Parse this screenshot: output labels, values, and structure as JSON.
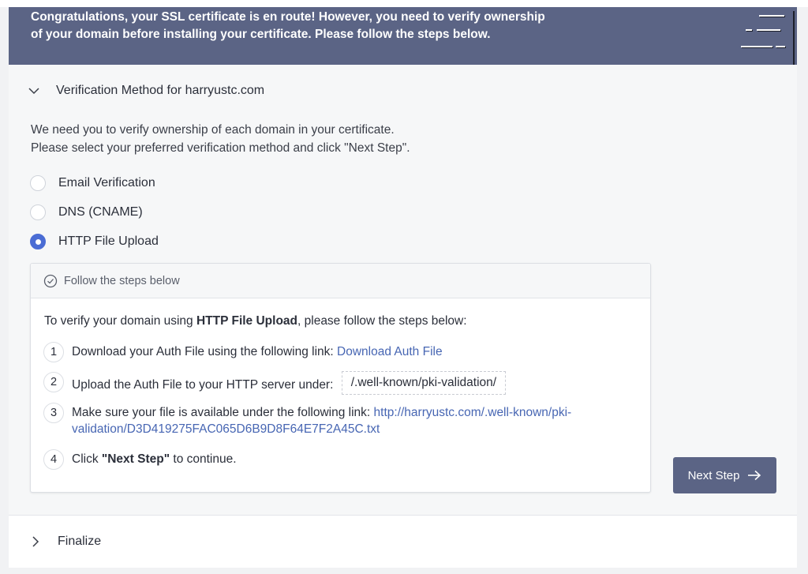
{
  "banner": {
    "message_line1": "Congratulations, your SSL certificate is en route! However, you need to verify ownership",
    "message_line2": "of your domain before installing your certificate. Please follow the steps below."
  },
  "verification": {
    "title": "Verification Method for harryustc.com",
    "intro_line1": "We need you to verify ownership of each domain in your certificate.",
    "intro_line2": "Please select your preferred verification method and click \"Next Step\".",
    "methods": [
      {
        "label": "Email Verification",
        "checked": false
      },
      {
        "label": "DNS (CNAME)",
        "checked": false
      },
      {
        "label": "HTTP File Upload",
        "checked": true
      }
    ]
  },
  "steps_panel": {
    "header": "Follow the steps below",
    "lead_prefix": "To verify your domain using ",
    "lead_bold": "HTTP File Upload",
    "lead_suffix": ", please follow the steps below:",
    "steps": [
      {
        "num": "1",
        "text": "Download your Auth File using the following link: ",
        "link": "Download Auth File"
      },
      {
        "num": "2",
        "text": "Upload the Auth File to your HTTP server under:",
        "path": "/.well-known/pki-validation/"
      },
      {
        "num": "3",
        "text": "Make sure your file is available under the following link: ",
        "link_line1": "http://harryustc.com/.well-known/pki-",
        "link_line2": "validation/D3D419275FAC065D6B9D8F64E7F2A45C.txt"
      },
      {
        "num": "4",
        "text_prefix": "Click ",
        "text_bold": "\"Next Step\"",
        "text_suffix": " to continue."
      }
    ]
  },
  "next_button": {
    "label": "Next Step"
  },
  "finalize": {
    "title": "Finalize"
  },
  "colors": {
    "banner": "#5b6485",
    "accent": "#4a6cd4",
    "link": "#4766b3"
  }
}
